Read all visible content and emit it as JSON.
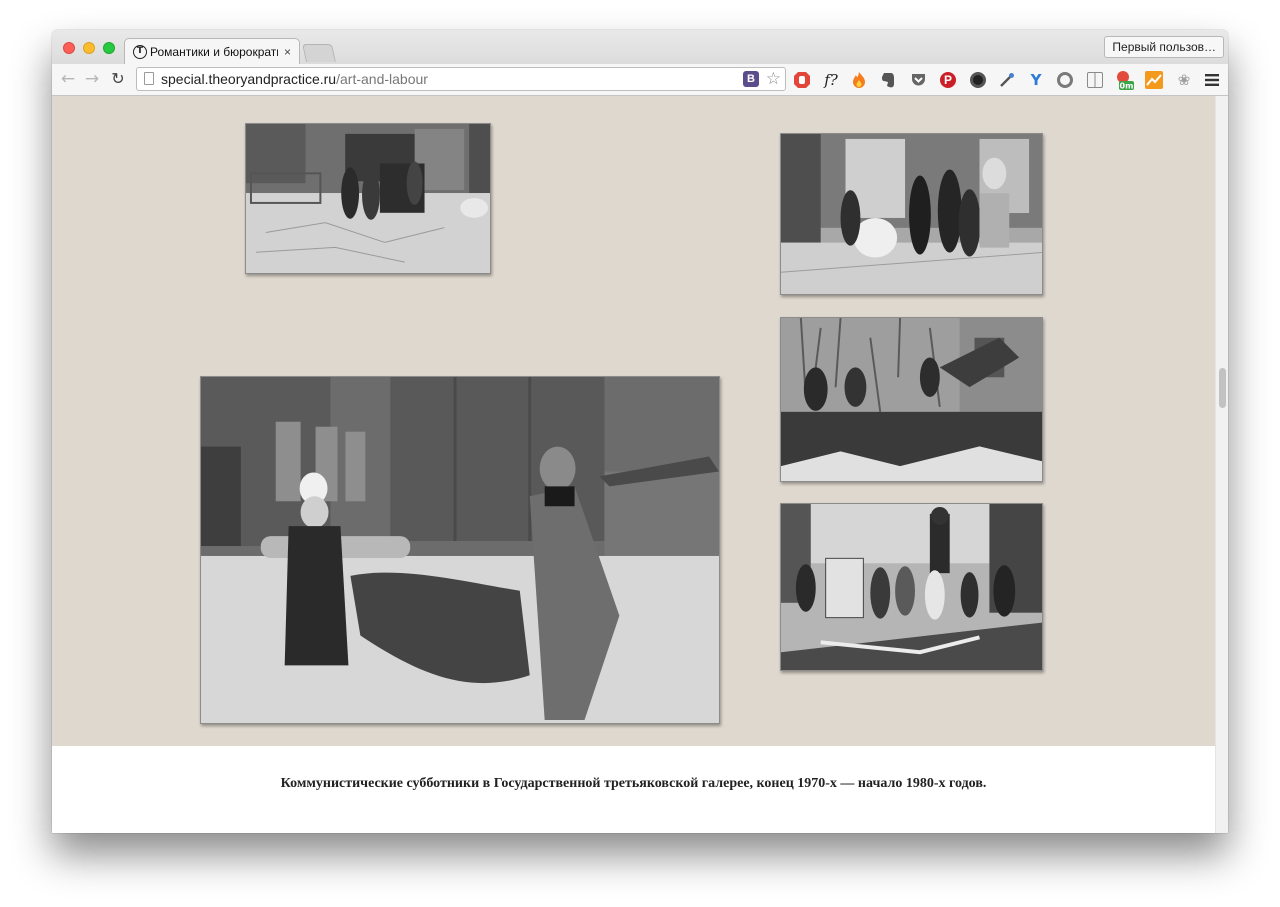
{
  "browser": {
    "tab": {
      "title": "Романтики и бюрократы:",
      "favicon": "T",
      "close": "×"
    },
    "profile_button": "Первый пользов…",
    "address": {
      "host": "special.theoryandpractice.ru",
      "path": "/art-and-labour"
    },
    "vk_badge": "B",
    "extensions": [
      {
        "name": "adblock-icon",
        "color": "#e2463b"
      },
      {
        "name": "fact-check-icon",
        "label": "f?"
      },
      {
        "name": "flame-icon",
        "color": "#f57c1f"
      },
      {
        "name": "evernote-icon",
        "color": "#555555"
      },
      {
        "name": "pocket-icon",
        "color": "#666666"
      },
      {
        "name": "pinterest-icon",
        "color": "#cb2027"
      },
      {
        "name": "camera-lens-icon",
        "color": "#222222"
      },
      {
        "name": "eyedropper-icon",
        "color": "#555555"
      },
      {
        "name": "y-icon",
        "color": "#2a7bd6"
      },
      {
        "name": "ring-icon",
        "color": "#777777"
      },
      {
        "name": "reader-icon",
        "color": "#8a8a8a"
      },
      {
        "name": "weather-icon",
        "color": "#e24b3b",
        "badge": "0m"
      },
      {
        "name": "analytics-icon",
        "color": "#f39a1d"
      },
      {
        "name": "paw-icon",
        "color": "#9a9a9a"
      },
      {
        "name": "menu-icon",
        "color": "#333333"
      }
    ]
  },
  "gallery": {
    "background": "#ded8ce",
    "photos": [
      {
        "name": "photo-workers-pushing-cart"
      },
      {
        "name": "photo-moving-sculpture-indoors"
      },
      {
        "name": "photo-digging-in-garden"
      },
      {
        "name": "photo-cleaning-snow-near-statue"
      },
      {
        "name": "photo-carrying-tarp"
      }
    ]
  },
  "caption": "Коммунистические субботники в Государственной третьяковской галерее, конец 1970-х — начало 1980-х годов."
}
